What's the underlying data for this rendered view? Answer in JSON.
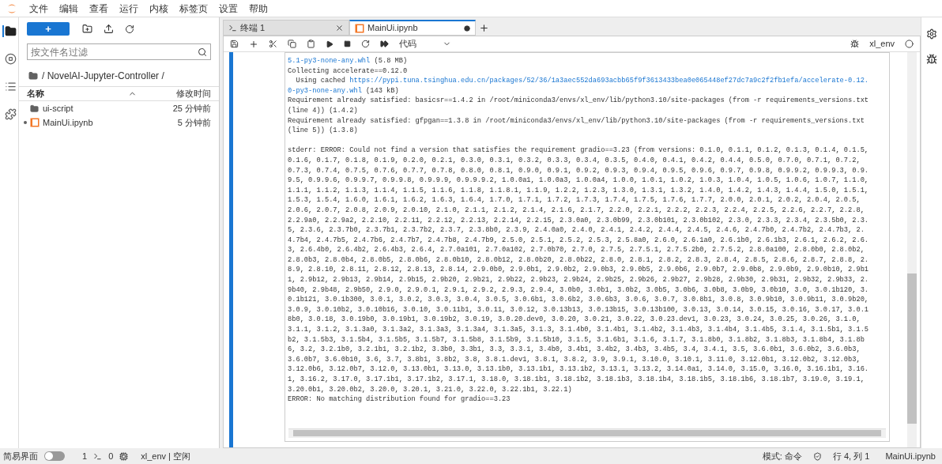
{
  "menu": [
    "文件",
    "编辑",
    "查看",
    "运行",
    "内核",
    "标签页",
    "设置",
    "帮助"
  ],
  "activity_bar": [
    {
      "kind": "folder",
      "selected": true
    },
    {
      "kind": "running",
      "selected": false
    },
    {
      "kind": "toc",
      "selected": false
    },
    {
      "kind": "extensions",
      "selected": false
    }
  ],
  "file_browser": {
    "new_button": "+",
    "filter": {
      "placeholder": "按文件名过滤"
    },
    "breadcrumb": "/ NovelAI-Jupyter-Controller /",
    "columns": [
      "名称",
      "修改时间"
    ],
    "files": [
      {
        "kind": "folder",
        "name": "ui-script",
        "modified": "25 分钟前",
        "running": false
      },
      {
        "kind": "notebook",
        "name": "MainUi.ipynb",
        "modified": "5 分钟前",
        "running": true
      }
    ]
  },
  "tabs": [
    {
      "kind": "terminal",
      "label": "终端 1",
      "selected": false,
      "unsaved": false
    },
    {
      "kind": "notebook",
      "label": "MainUi.ipynb",
      "selected": true,
      "unsaved": true
    }
  ],
  "toolbar": {
    "cell_type": "代码",
    "kernel": "xl_env"
  },
  "output": [
    [
      {
        "text": "5.1-py3-none-any.whl",
        "link": true
      },
      {
        "text": " (5.8 MB)",
        "link": false
      }
    ],
    [
      {
        "text": "Collecting accelerate==0.12.0",
        "link": false
      }
    ],
    [
      {
        "text": "  Using cached ",
        "link": false
      },
      {
        "text": "https://pypi.tuna.tsinghua.edu.cn/packages/52/36/1a3aec552da693acbb65f9f3613433bea0e065448ef27dc7a9c2f2fb1efa/accelerate-0.12.",
        "link": true
      }
    ],
    [
      {
        "text": "0-py3-none-any.whl",
        "link": true
      },
      {
        "text": " (143 kB)",
        "link": false
      }
    ],
    [
      {
        "text": "Requirement already satisfied: basicsr==1.4.2 in /root/miniconda3/envs/xl_env/lib/python3.10/site-packages (from -r requirements_versions.txt",
        "link": false
      }
    ],
    [
      {
        "text": "(line 4)) (1.4.2)",
        "link": false
      }
    ],
    [
      {
        "text": "Requirement already satisfied: gfpgan==1.3.8 in /root/miniconda3/envs/xl_env/lib/python3.10/site-packages (from -r requirements_versions.txt",
        "link": false
      }
    ],
    [
      {
        "text": "(line 5)) (1.3.8)",
        "link": false
      }
    ],
    [
      {
        "text": "stderr: ERROR: Could not find a version that satisfies the requirement gradio==3.23 (from versions: 0.1.0, 0.1.1, 0.1.2, 0.1.3, 0.1.4, 0.1.5,",
        "link": false,
        "blank_before": true
      }
    ],
    [
      {
        "text": "0.1.6, 0.1.7, 0.1.8, 0.1.9, 0.2.0, 0.2.1, 0.3.0, 0.3.1, 0.3.2, 0.3.3, 0.3.4, 0.3.5, 0.4.0, 0.4.1, 0.4.2, 0.4.4, 0.5.0, 0.7.0, 0.7.1, 0.7.2,",
        "link": false
      }
    ],
    [
      {
        "text": "0.7.3, 0.7.4, 0.7.5, 0.7.6, 0.7.7, 0.7.8, 0.8.0, 0.8.1, 0.9.0, 0.9.1, 0.9.2, 0.9.3, 0.9.4, 0.9.5, 0.9.6, 0.9.7, 0.9.8, 0.9.9.2, 0.9.9.3, 0.9.",
        "link": false
      }
    ],
    [
      {
        "text": "9.5, 0.9.9.6, 0.9.9.7, 0.9.9.8, 0.9.9.9, 0.9.9.9.2, 1.0.0a1, 1.0.0a3, 1.0.0a4, 1.0.0, 1.0.1, 1.0.2, 1.0.3, 1.0.4, 1.0.5, 1.0.6, 1.0.7, 1.1.0,",
        "link": false
      }
    ],
    [
      {
        "text": "1.1.1, 1.1.2, 1.1.3, 1.1.4, 1.1.5, 1.1.6, 1.1.8, 1.1.8.1, 1.1.9, 1.2.2, 1.2.3, 1.3.0, 1.3.1, 1.3.2, 1.4.0, 1.4.2, 1.4.3, 1.4.4, 1.5.0, 1.5.1,",
        "link": false
      }
    ],
    [
      {
        "text": "1.5.3, 1.5.4, 1.6.0, 1.6.1, 1.6.2, 1.6.3, 1.6.4, 1.7.0, 1.7.1, 1.7.2, 1.7.3, 1.7.4, 1.7.5, 1.7.6, 1.7.7, 2.0.0, 2.0.1, 2.0.2, 2.0.4, 2.0.5,",
        "link": false
      }
    ],
    [
      {
        "text": "2.0.6, 2.0.7, 2.0.8, 2.0.9, 2.0.10, 2.1.0, 2.1.1, 2.1.2, 2.1.4, 2.1.6, 2.1.7, 2.2.0, 2.2.1, 2.2.2, 2.2.3, 2.2.4, 2.2.5, 2.2.6, 2.2.7, 2.2.8,",
        "link": false
      }
    ],
    [
      {
        "text": "2.2.9a0, 2.2.9a2, 2.2.10, 2.2.11, 2.2.12, 2.2.13, 2.2.14, 2.2.15, 2.3.0a0, 2.3.0b99, 2.3.0b101, 2.3.0b102, 2.3.0, 2.3.3, 2.3.4, 2.3.5b0, 2.3.",
        "link": false
      }
    ],
    [
      {
        "text": "5, 2.3.6, 2.3.7b0, 2.3.7b1, 2.3.7b2, 2.3.7, 2.3.8b0, 2.3.9, 2.4.0a0, 2.4.0, 2.4.1, 2.4.2, 2.4.4, 2.4.5, 2.4.6, 2.4.7b0, 2.4.7b2, 2.4.7b3, 2.",
        "link": false
      }
    ],
    [
      {
        "text": "4.7b4, 2.4.7b5, 2.4.7b6, 2.4.7b7, 2.4.7b8, 2.4.7b9, 2.5.0, 2.5.1, 2.5.2, 2.5.3, 2.5.8a0, 2.6.0, 2.6.1a0, 2.6.1b0, 2.6.1b3, 2.6.1, 2.6.2, 2.6.",
        "link": false
      }
    ],
    [
      {
        "text": "3, 2.6.4b0, 2.6.4b2, 2.6.4b3, 2.6.4, 2.7.0a101, 2.7.0a102, 2.7.0b70, 2.7.0, 2.7.5, 2.7.5.1, 2.7.5.2b0, 2.7.5.2, 2.8.0a100, 2.8.0b0, 2.8.0b2,",
        "link": false
      }
    ],
    [
      {
        "text": "2.8.0b3, 2.8.0b4, 2.8.0b5, 2.8.0b6, 2.8.0b10, 2.8.0b12, 2.8.0b20, 2.8.0b22, 2.8.0, 2.8.1, 2.8.2, 2.8.3, 2.8.4, 2.8.5, 2.8.6, 2.8.7, 2.8.8, 2.",
        "link": false
      }
    ],
    [
      {
        "text": "8.9, 2.8.10, 2.8.11, 2.8.12, 2.8.13, 2.8.14, 2.9.0b0, 2.9.0b1, 2.9.0b2, 2.9.0b3, 2.9.0b5, 2.9.0b6, 2.9.0b7, 2.9.0b8, 2.9.0b9, 2.9.0b10, 2.9b1",
        "link": false
      }
    ],
    [
      {
        "text": "1, 2.9b12, 2.9b13, 2.9b14, 2.9b15, 2.9b20, 2.9b21, 2.9b22, 2.9b23, 2.9b24, 2.9b25, 2.9b26, 2.9b27, 2.9b28, 2.9b30, 2.9b31, 2.9b32, 2.9b33, 2.",
        "link": false
      }
    ],
    [
      {
        "text": "9b40, 2.9b48, 2.9b50, 2.9.0, 2.9.0.1, 2.9.1, 2.9.2, 2.9.3, 2.9.4, 3.0b0, 3.0b1, 3.0b2, 3.0b5, 3.0b6, 3.0b8, 3.0b9, 3.0b10, 3.0, 3.0.1b120, 3.",
        "link": false
      }
    ],
    [
      {
        "text": "0.1b121, 3.0.1b300, 3.0.1, 3.0.2, 3.0.3, 3.0.4, 3.0.5, 3.0.6b1, 3.0.6b2, 3.0.6b3, 3.0.6, 3.0.7, 3.0.8b1, 3.0.8, 3.0.9b10, 3.0.9b11, 3.0.9b20,",
        "link": false
      }
    ],
    [
      {
        "text": "3.0.9, 3.0.10b2, 3.0.10b16, 3.0.10, 3.0.11b1, 3.0.11, 3.0.12, 3.0.13b13, 3.0.13b15, 3.0.13b100, 3.0.13, 3.0.14, 3.0.15, 3.0.16, 3.0.17, 3.0.1",
        "link": false
      }
    ],
    [
      {
        "text": "8b0, 3.0.18, 3.0.19b0, 3.0.19b1, 3.0.19b2, 3.0.19, 3.0.20.dev0, 3.0.20, 3.0.21, 3.0.22, 3.0.23.dev1, 3.0.23, 3.0.24, 3.0.25, 3.0.26, 3.1.0,",
        "link": false
      }
    ],
    [
      {
        "text": "3.1.1, 3.1.2, 3.1.3a0, 3.1.3a2, 3.1.3a3, 3.1.3a4, 3.1.3a5, 3.1.3, 3.1.4b0, 3.1.4b1, 3.1.4b2, 3.1.4b3, 3.1.4b4, 3.1.4b5, 3.1.4, 3.1.5b1, 3.1.5",
        "link": false
      }
    ],
    [
      {
        "text": "b2, 3.1.5b3, 3.1.5b4, 3.1.5b5, 3.1.5b7, 3.1.5b8, 3.1.5b9, 3.1.5b10, 3.1.5, 3.1.6b1, 3.1.6, 3.1.7, 3.1.8b0, 3.1.8b2, 3.1.8b3, 3.1.8b4, 3.1.8b",
        "link": false
      }
    ],
    [
      {
        "text": "6, 3.2, 3.2.1b0, 3.2.1b1, 3.2.1b2, 3.3b0, 3.3b1, 3.3, 3.3.1, 3.4b0, 3.4b1, 3.4b2, 3.4b3, 3.4b5, 3.4, 3.4.1, 3.5, 3.6.0b1, 3.6.0b2, 3.6.0b3,",
        "link": false
      }
    ],
    [
      {
        "text": "3.6.0b7, 3.6.0b10, 3.6, 3.7, 3.8b1, 3.8b2, 3.8, 3.8.1.dev1, 3.8.1, 3.8.2, 3.9, 3.9.1, 3.10.0, 3.10.1, 3.11.0, 3.12.0b1, 3.12.0b2, 3.12.0b3,",
        "link": false
      }
    ],
    [
      {
        "text": "3.12.0b6, 3.12.0b7, 3.12.0, 3.13.0b1, 3.13.0, 3.13.1b0, 3.13.1b1, 3.13.1b2, 3.13.1, 3.13.2, 3.14.0a1, 3.14.0, 3.15.0, 3.16.0, 3.16.1b1, 3.16.",
        "link": false
      }
    ],
    [
      {
        "text": "1, 3.16.2, 3.17.0, 3.17.1b1, 3.17.1b2, 3.17.1, 3.18.0, 3.18.1b1, 3.18.1b2, 3.18.1b3, 3.18.1b4, 3.18.1b5, 3.18.1b6, 3.18.1b7, 3.19.0, 3.19.1,",
        "link": false
      }
    ],
    [
      {
        "text": "3.20.0b1, 3.20.0b2, 3.20.0, 3.20.1, 3.21.0, 3.22.0, 3.22.1b1, 3.22.1)",
        "link": false
      }
    ],
    [
      {
        "text": "ERROR: No matching distribution found for gradio==3.23",
        "link": false
      }
    ]
  ],
  "status_bar": {
    "simple_mode": {
      "label": "简易界面",
      "on": false
    },
    "terminals": "1",
    "kernels": "0",
    "kernel_status": "xl_env | 空闲",
    "mode": "模式: 命令",
    "position": "行 4, 列 1",
    "file": "MainUi.ipynb"
  }
}
